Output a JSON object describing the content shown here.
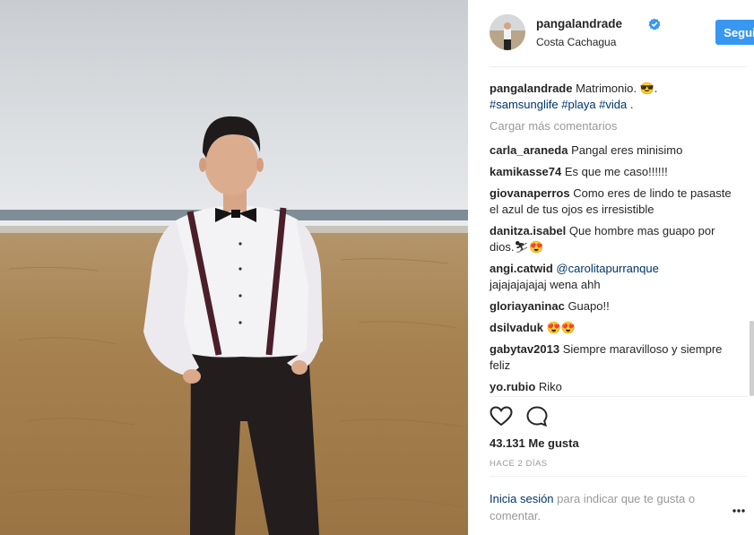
{
  "post": {
    "username": "pangalandrade",
    "location": "Costa Cachagua",
    "follow_label": "Seguir",
    "caption_text": "Matrimonio. 😎.",
    "caption_tags": [
      "#samsunglife",
      "#playa",
      "#vida"
    ],
    "caption_tail": ".",
    "load_more": "Cargar más comentarios",
    "likes": "43.131 Me gusta",
    "time": "HACE 2 DÍAS",
    "login_link": "Inicia sesión",
    "login_rest": "para indicar que te gusta o comentar."
  },
  "comments": [
    {
      "user": "carla_araneda",
      "text": "Pangal eres minisimo"
    },
    {
      "user": "kamikasse74",
      "text": "Es que me caso!!!!!!"
    },
    {
      "user": "giovanaperros",
      "text": "Como eres de lindo te pasaste el azul de tus ojos es irresistible"
    },
    {
      "user": "danitza.isabel",
      "text": "Que hombre mas guapo por dios.⛷😍"
    },
    {
      "user": "angi.catwid",
      "mention": "@carolitapurranque",
      "text": "jajajajajajaj wena ahh"
    },
    {
      "user": "gloriayaninac",
      "text": "Guapo!!"
    },
    {
      "user": "dsilvaduk",
      "text": "😍😍"
    },
    {
      "user": "gabytav2013",
      "text": "Siempre maravilloso y siempre feliz"
    },
    {
      "user": "yo.rubio",
      "text": "Riko"
    }
  ],
  "icons": {
    "verified": "verified-badge-icon",
    "like": "heart-icon",
    "comment": "comment-bubble-icon",
    "more": "more-options-icon"
  },
  "colors": {
    "accent": "#3897f0",
    "link": "#003569",
    "muted": "#999999",
    "text": "#262626"
  }
}
